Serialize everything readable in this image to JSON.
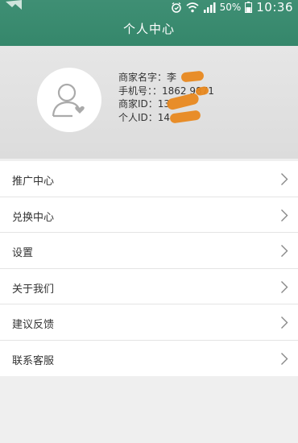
{
  "status_bar": {
    "battery": "50%",
    "time": "10:36"
  },
  "header": {
    "title": "个人中心"
  },
  "profile": {
    "merchant_name_label": "商家名字：",
    "merchant_name_value": "李",
    "phone_label": "手机号：：",
    "phone_value": "1862 9871",
    "merchant_id_label": "商家ID：",
    "merchant_id_value": "13",
    "personal_id_label": "个人ID：",
    "personal_id_value": "14"
  },
  "menu": {
    "items": [
      {
        "label": "推广中心"
      },
      {
        "label": "兑换中心"
      },
      {
        "label": "设置"
      },
      {
        "label": "关于我们"
      },
      {
        "label": "建议反馈"
      },
      {
        "label": "联系客服"
      }
    ]
  },
  "colors": {
    "header_green": "#3f8f74",
    "redaction_orange": "#e8881f"
  }
}
